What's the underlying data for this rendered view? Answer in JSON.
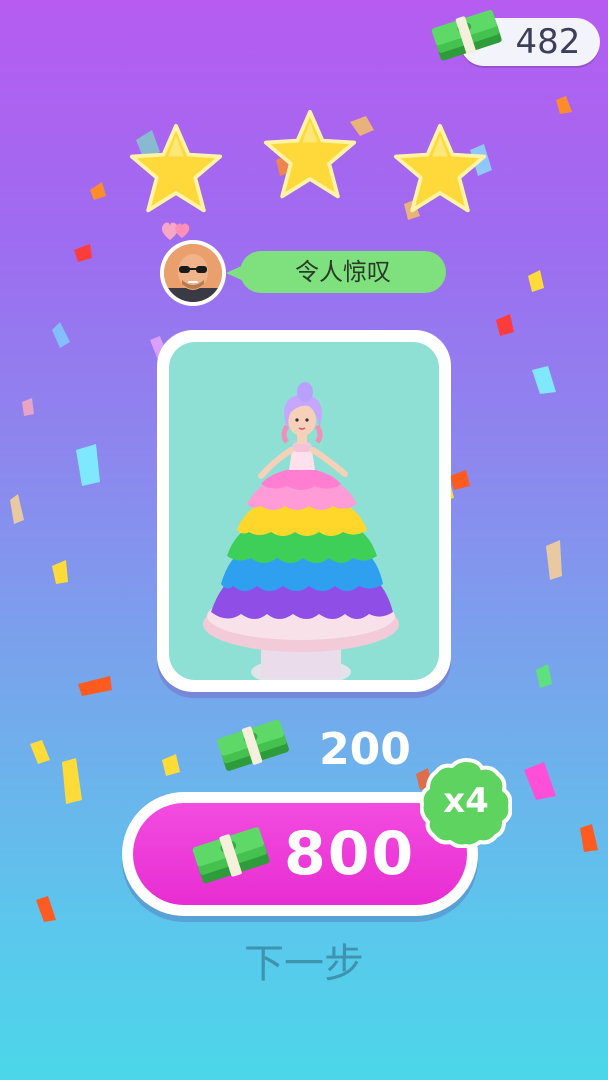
{
  "hud": {
    "coins": "482",
    "coin_icon": "cash-stack-icon"
  },
  "rating": {
    "stars_earned": 3,
    "stars_total": 3,
    "star_color": "#ffd83a"
  },
  "reviewer": {
    "avatar_icon": "bald-man-sunglasses-avatar",
    "comment": "令人惊叹"
  },
  "result": {
    "image": "rainbow-ruffle-princess-cake",
    "reward": "200",
    "reward_icon": "cash-stack-icon"
  },
  "multiply_button": {
    "total": "800",
    "multiplier": "x4",
    "icon": "cash-stack-icon",
    "color": "#e82dd2"
  },
  "next_button": {
    "label": "下一步"
  },
  "colors": {
    "background_top": "#b65cf1",
    "background_bottom": "#4bd7ea",
    "cash_green": "#4ccf4f",
    "badge_green": "#5fd35f"
  }
}
